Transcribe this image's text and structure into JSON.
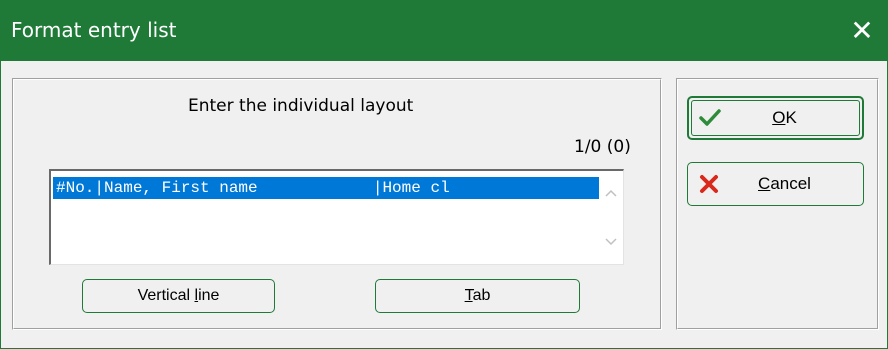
{
  "window": {
    "title": "Format entry list",
    "close_glyph": "✕"
  },
  "main": {
    "heading": "Enter the individual layout",
    "counter": "1/0 (0)",
    "list_items": [
      "#No.|Name, First name            |Home cl"
    ],
    "vertical_line_button": {
      "label_prefix": "Vertical ",
      "label_hotkey": "l",
      "label_suffix": "ine"
    },
    "tab_button": {
      "label_hotkey": "T",
      "label_suffix": "ab"
    }
  },
  "actions": {
    "ok_button": {
      "label_hotkey": "O",
      "label_suffix": "K",
      "icon": "check-icon"
    },
    "cancel_button": {
      "label_hotkey": "C",
      "label_suffix": "ancel",
      "icon": "x-icon"
    }
  },
  "colors": {
    "titlebar": "#1f7a38",
    "selection": "#0078d7",
    "check_green": "#2e8b3a",
    "x_red": "#d9291c"
  }
}
